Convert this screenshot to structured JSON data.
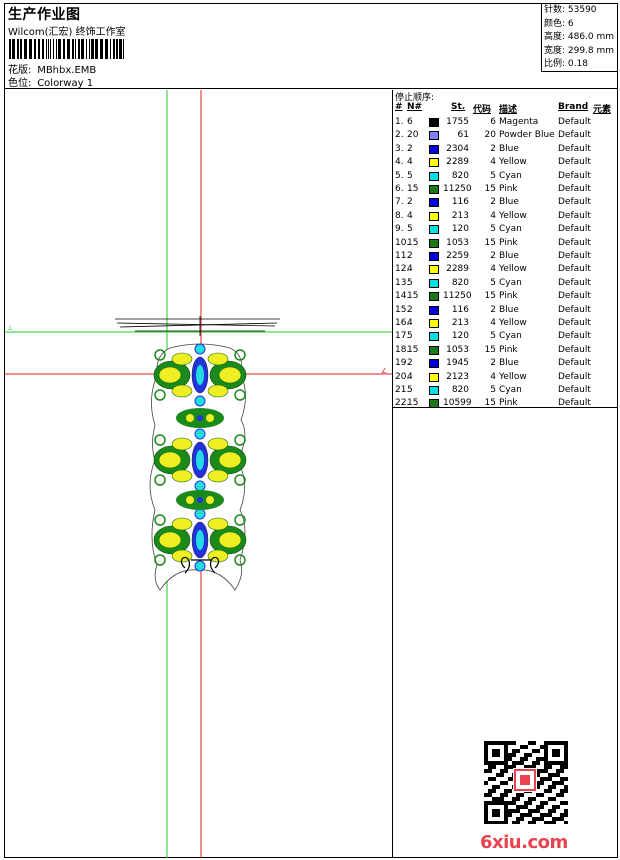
{
  "header": {
    "title": "生产作业图",
    "subtitle": "Wilcom(汇宏) 终饰工作室",
    "design_label": "花版:",
    "design_file": "MBhbx.EMB",
    "colorway_label": "色位:",
    "colorway": "Colorway 1"
  },
  "stats": {
    "stitches": "针数: 53590",
    "colors": "颜色: 6",
    "height": "高度: 486.0 mm",
    "width": "宽度: 299.8 mm",
    "scale": "比例: 0.18"
  },
  "stop_sequence": {
    "title": "停止顺序:",
    "columns": [
      "#",
      "N#",
      "St.",
      "代码",
      "描述",
      "Brand",
      "元素"
    ],
    "rows": [
      {
        "idx": "1.",
        "n": "6",
        "color": "#000000",
        "st": "1755",
        "code": "6",
        "desc": "Magenta",
        "brand": "Default"
      },
      {
        "idx": "2.",
        "n": "20",
        "color": "#8080ff",
        "st": "61",
        "code": "20",
        "desc": "Powder Blue",
        "brand": "Default"
      },
      {
        "idx": "3.",
        "n": "2",
        "color": "#0000dd",
        "st": "2304",
        "code": "2",
        "desc": "Blue",
        "brand": "Default"
      },
      {
        "idx": "4.",
        "n": "4",
        "color": "#ffff00",
        "st": "2289",
        "code": "4",
        "desc": "Yellow",
        "brand": "Default"
      },
      {
        "idx": "5.",
        "n": "5",
        "color": "#00e0e0",
        "st": "820",
        "code": "5",
        "desc": "Cyan",
        "brand": "Default"
      },
      {
        "idx": "6.",
        "n": "15",
        "color": "#1a7a1a",
        "st": "11250",
        "code": "15",
        "desc": "Pink",
        "brand": "Default"
      },
      {
        "idx": "7.",
        "n": "2",
        "color": "#0000dd",
        "st": "116",
        "code": "2",
        "desc": "Blue",
        "brand": "Default"
      },
      {
        "idx": "8.",
        "n": "4",
        "color": "#ffff00",
        "st": "213",
        "code": "4",
        "desc": "Yellow",
        "brand": "Default"
      },
      {
        "idx": "9.",
        "n": "5",
        "color": "#00e0e0",
        "st": "120",
        "code": "5",
        "desc": "Cyan",
        "brand": "Default"
      },
      {
        "idx": "10.",
        "n": "15",
        "color": "#1a7a1a",
        "st": "1053",
        "code": "15",
        "desc": "Pink",
        "brand": "Default"
      },
      {
        "idx": "11.",
        "n": "2",
        "color": "#0000dd",
        "st": "2259",
        "code": "2",
        "desc": "Blue",
        "brand": "Default"
      },
      {
        "idx": "12.",
        "n": "4",
        "color": "#ffff00",
        "st": "2289",
        "code": "4",
        "desc": "Yellow",
        "brand": "Default"
      },
      {
        "idx": "13.",
        "n": "5",
        "color": "#00e0e0",
        "st": "820",
        "code": "5",
        "desc": "Cyan",
        "brand": "Default"
      },
      {
        "idx": "14.",
        "n": "15",
        "color": "#1a7a1a",
        "st": "11250",
        "code": "15",
        "desc": "Pink",
        "brand": "Default"
      },
      {
        "idx": "15.",
        "n": "2",
        "color": "#0000dd",
        "st": "116",
        "code": "2",
        "desc": "Blue",
        "brand": "Default"
      },
      {
        "idx": "16.",
        "n": "4",
        "color": "#ffff00",
        "st": "213",
        "code": "4",
        "desc": "Yellow",
        "brand": "Default"
      },
      {
        "idx": "17.",
        "n": "5",
        "color": "#00e0e0",
        "st": "120",
        "code": "5",
        "desc": "Cyan",
        "brand": "Default"
      },
      {
        "idx": "18.",
        "n": "15",
        "color": "#1a7a1a",
        "st": "1053",
        "code": "15",
        "desc": "Pink",
        "brand": "Default"
      },
      {
        "idx": "19.",
        "n": "2",
        "color": "#0000dd",
        "st": "1945",
        "code": "2",
        "desc": "Blue",
        "brand": "Default"
      },
      {
        "idx": "20.",
        "n": "4",
        "color": "#ffff00",
        "st": "2123",
        "code": "4",
        "desc": "Yellow",
        "brand": "Default"
      },
      {
        "idx": "21.",
        "n": "5",
        "color": "#00e0e0",
        "st": "820",
        "code": "5",
        "desc": "Cyan",
        "brand": "Default"
      },
      {
        "idx": "22.",
        "n": "15",
        "color": "#1a7a1a",
        "st": "10599",
        "code": "15",
        "desc": "Pink",
        "brand": "Default"
      }
    ]
  },
  "watermark": "6xiu.com",
  "icons": {
    "qr": "qr-code-icon",
    "seal": "seal-stamp-icon"
  }
}
